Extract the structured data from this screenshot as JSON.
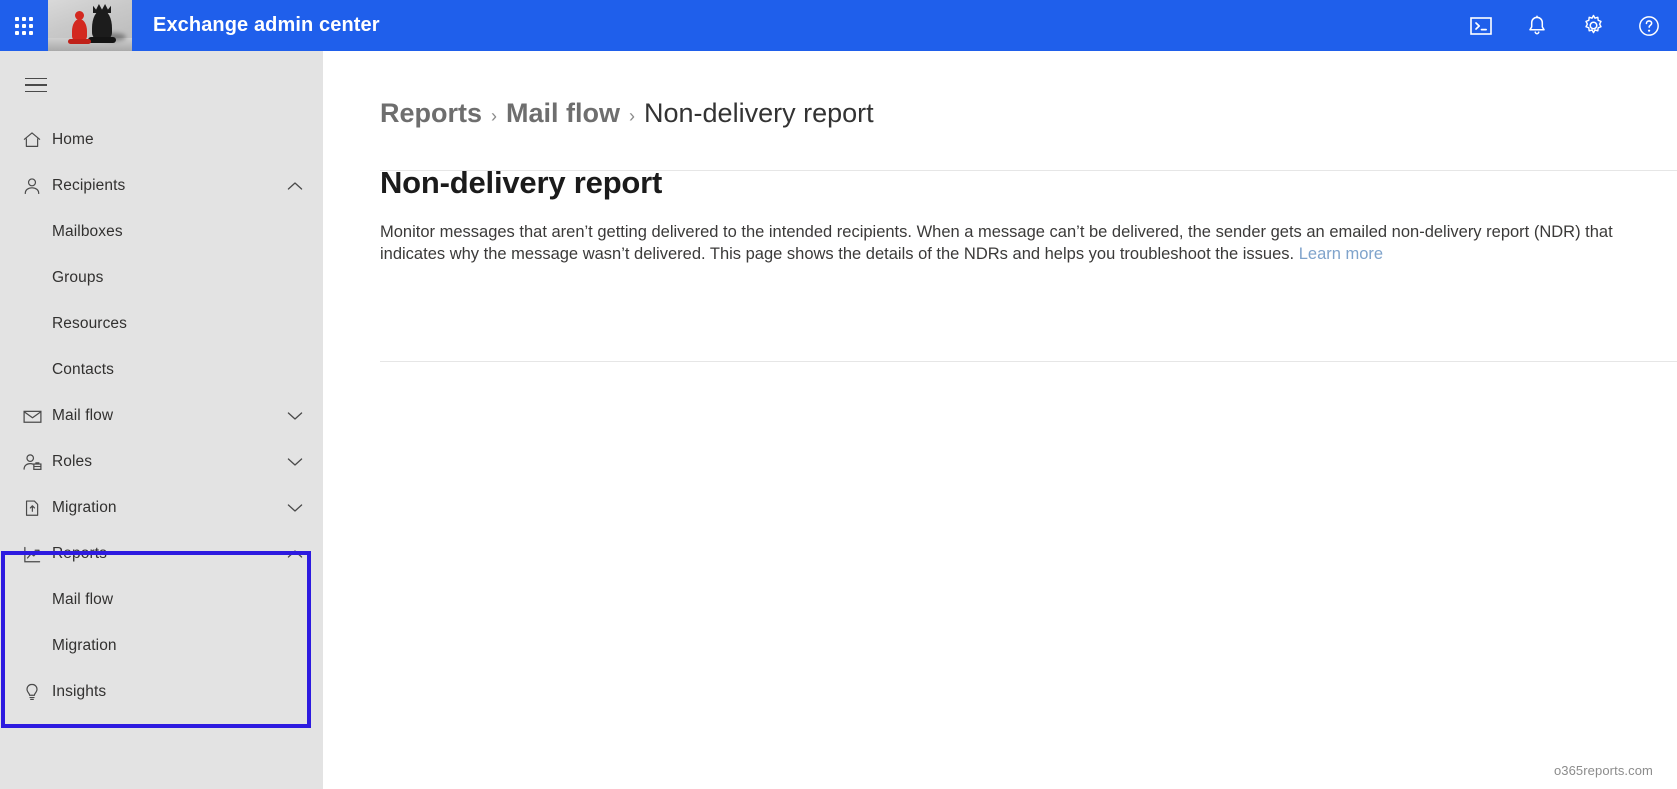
{
  "header": {
    "title": "Exchange admin center",
    "waffle_name": "app-launcher",
    "brand_image_alt": "chess-pieces-thumbnail",
    "icons": [
      {
        "name": "powershell-console-icon",
        "label": "Open console"
      },
      {
        "name": "notifications-bell-icon",
        "label": "Notifications"
      },
      {
        "name": "settings-gear-icon",
        "label": "Settings"
      },
      {
        "name": "help-question-icon",
        "label": "Help"
      }
    ],
    "accent_color": "#1f5feb"
  },
  "sidebar": {
    "background_color": "#e3e3e3",
    "hamburger_label": "Toggle navigation",
    "items": [
      {
        "label": "Home",
        "icon": "home-icon",
        "level": "top",
        "chevron": ""
      },
      {
        "label": "Recipients",
        "icon": "person-icon",
        "level": "top",
        "chevron": "up"
      },
      {
        "label": "Mailboxes",
        "icon": "",
        "level": "sub",
        "chevron": ""
      },
      {
        "label": "Groups",
        "icon": "",
        "level": "sub",
        "chevron": ""
      },
      {
        "label": "Resources",
        "icon": "",
        "level": "sub",
        "chevron": ""
      },
      {
        "label": "Contacts",
        "icon": "",
        "level": "sub",
        "chevron": ""
      },
      {
        "label": "Mail flow",
        "icon": "envelope-icon",
        "level": "top",
        "chevron": "down"
      },
      {
        "label": "Roles",
        "icon": "person-badge-icon",
        "level": "top",
        "chevron": "down"
      },
      {
        "label": "Migration",
        "icon": "migration-page-icon",
        "level": "top",
        "chevron": "down"
      },
      {
        "label": "Reports",
        "icon": "chart-trend-icon",
        "level": "top",
        "chevron": "up"
      },
      {
        "label": "Mail flow",
        "icon": "",
        "level": "sub",
        "chevron": ""
      },
      {
        "label": "Migration",
        "icon": "",
        "level": "sub",
        "chevron": ""
      },
      {
        "label": "Insights",
        "icon": "lightbulb-icon",
        "level": "top",
        "chevron": ""
      }
    ],
    "highlight": {
      "color": "#2d1ae0",
      "covers": [
        "Reports",
        "Mail flow",
        "Migration",
        "Insights"
      ]
    }
  },
  "main": {
    "breadcrumb": {
      "root": "Reports",
      "separator": "›",
      "parent": "Mail flow",
      "current": "Non-delivery report"
    },
    "page_title": "Non-delivery report",
    "description_part1": "Monitor messages that aren’t getting delivered to the intended recipients. When a message can’t be delivered, the sender gets an emailed non-delivery report (NDR) that indicates why the message wasn’t delivered. This page shows the details of the NDRs and helps you troubleshoot the issues. ",
    "learn_more": "Learn more",
    "learn_more_color": "#7fa3cb",
    "watermark": "o365reports.com"
  }
}
